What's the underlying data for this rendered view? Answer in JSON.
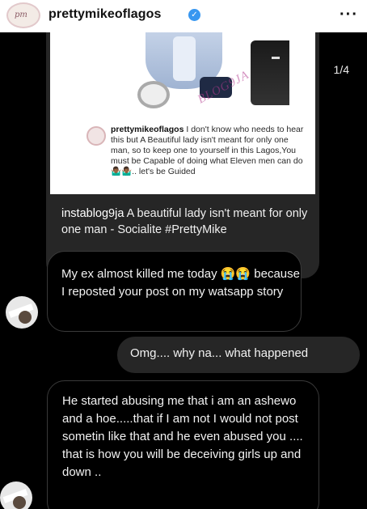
{
  "header": {
    "username": "prettymikeoflagos",
    "avatar_text": "pm",
    "more_icon": "more-horizontal-icon"
  },
  "post": {
    "counter": "1/4",
    "watermark": "BLOG9JA",
    "caption_user": "prettymikeoflagos",
    "caption_text": " I don't know who needs to hear this but A Beautiful lady isn't meant for only one man, so to keep one to yourself in this Lagos,You must be Capable of doing what Eleven men can do 🤷🏾‍♂️🤷🏾‍♂️.. let's be Guided",
    "shared_user": "instablog9ja",
    "shared_text": " A beautiful lady isn't meant for only one man - Socialite #PrettyMike"
  },
  "messages": [
    {
      "from": "them",
      "text": "My ex almost killed me today 😭😭 because I reposted your post on my watsapp story"
    },
    {
      "from": "me",
      "text": "Omg.... why na... what happened"
    },
    {
      "from": "them",
      "text": "He started abusing me that i am an ashewo and a hoe.....that if I am not I would not post sometin like that and he even abused you .... that is how you will be deceiving girls up and down .."
    }
  ],
  "colors": {
    "verified": "#3897f0",
    "dm_background": "#000000",
    "sent_bubble": "#262626",
    "received_border": "#3a3a3a"
  }
}
